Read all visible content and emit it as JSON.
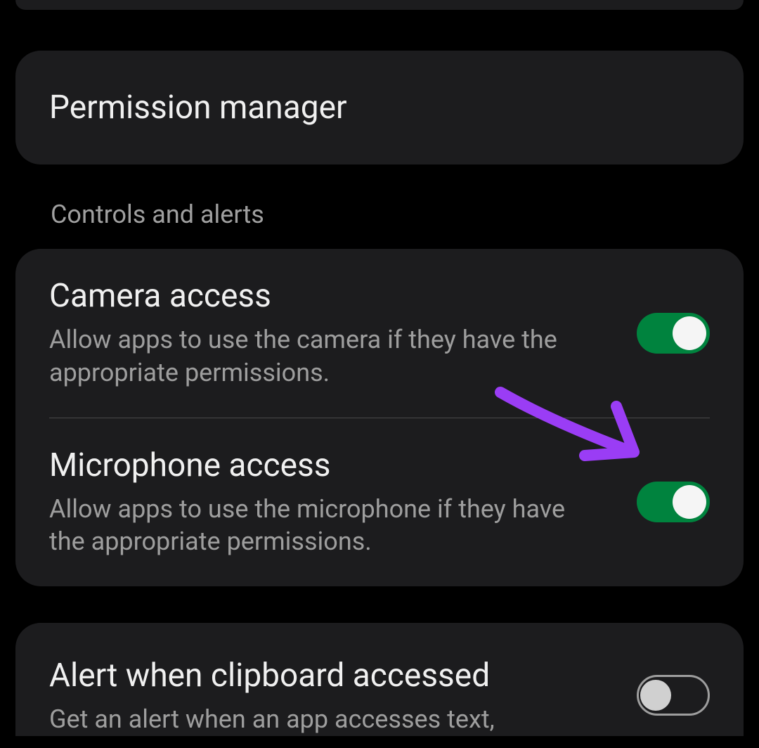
{
  "permission_manager": {
    "title": "Permission manager"
  },
  "sections": {
    "controls_alerts": {
      "header": "Controls and alerts",
      "items": {
        "camera": {
          "title": "Camera access",
          "desc": "Allow apps to use the camera if they have the appropriate permissions.",
          "enabled": true
        },
        "microphone": {
          "title": "Microphone access",
          "desc": "Allow apps to use the microphone if they have the appropriate permissions.",
          "enabled": true
        }
      }
    }
  },
  "clipboard_alert": {
    "title": "Alert when clipboard accessed",
    "desc": "Get an alert when an app accesses text,",
    "enabled": false
  },
  "colors": {
    "toggle_on": "#00833e",
    "background": "#000000",
    "card": "#1c1c1e",
    "annotation": "#9a3df5"
  }
}
